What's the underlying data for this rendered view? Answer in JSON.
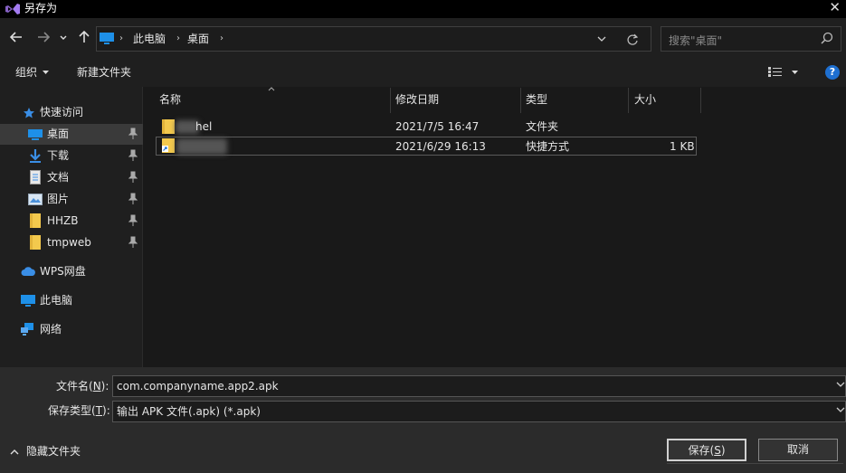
{
  "window": {
    "title": "另存为",
    "close_glyph": "✕"
  },
  "nav": {
    "back_icon": "arrow-left-icon",
    "forward_icon": "arrow-right-icon",
    "up_icon": "arrow-up-icon",
    "breadcrumbs": [
      "此电脑",
      "桌面"
    ],
    "search_placeholder": "搜索\"桌面\""
  },
  "toolbar": {
    "organize": "组织",
    "new_folder": "新建文件夹"
  },
  "sidebar": {
    "quick_access": "快速访问",
    "items": [
      {
        "label": "桌面",
        "pinned": true
      },
      {
        "label": "下载",
        "pinned": true
      },
      {
        "label": "文档",
        "pinned": true
      },
      {
        "label": "图片",
        "pinned": true
      },
      {
        "label": "HHZB",
        "pinned": true
      },
      {
        "label": "tmpweb",
        "pinned": true
      }
    ],
    "wps": "WPS网盘",
    "this_pc": "此电脑",
    "network": "网络"
  },
  "columns": {
    "name": "名称",
    "modified": "修改日期",
    "type": "类型",
    "size": "大小"
  },
  "files": [
    {
      "name_suffix": "hel",
      "modified": "2021/7/5 16:47",
      "type": "文件夹",
      "size": ""
    },
    {
      "name_suffix": "",
      "modified": "2021/6/29 16:13",
      "type": "快捷方式",
      "size": "1 KB"
    }
  ],
  "form": {
    "filename_label": "文件名(",
    "filename_key": "N",
    "filename_label_end": "):",
    "filename_value": "com.companyname.app2.apk",
    "filetype_label": "保存类型(",
    "filetype_key": "T",
    "filetype_label_end": "):",
    "filetype_value": "输出 APK 文件(.apk) (*.apk)"
  },
  "footer": {
    "hide_folders": "隐藏文件夹",
    "save_label": "保存(",
    "save_key": "S",
    "save_label_end": ")",
    "cancel_label": "取消"
  }
}
